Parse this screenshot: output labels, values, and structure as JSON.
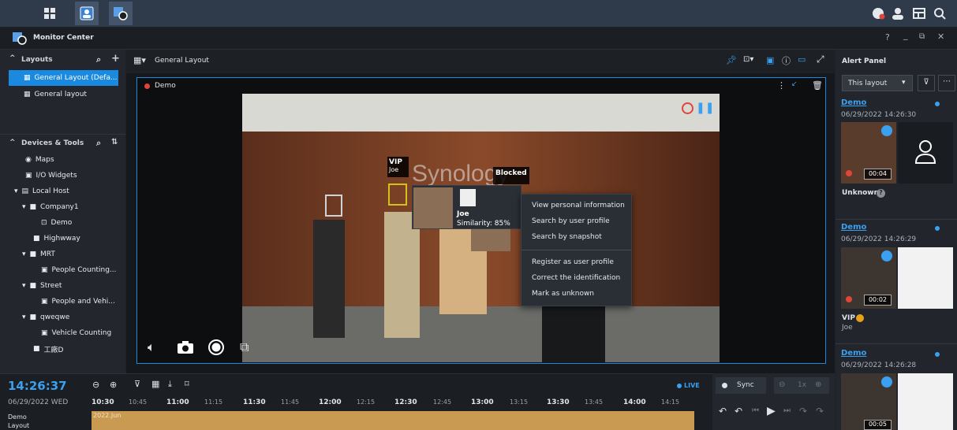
{
  "title": "Monitor Center",
  "layouts": {
    "header": "Layouts",
    "items": [
      "General Layout (Defa...",
      "General layout"
    ]
  },
  "devices": {
    "header": "Devices & Tools",
    "items": [
      {
        "label": "Maps"
      },
      {
        "label": "I/O Widgets"
      },
      {
        "label": "Local Host"
      },
      {
        "label": "Company1"
      },
      {
        "label": "Demo"
      },
      {
        "label": "Highwway"
      },
      {
        "label": "MRT"
      },
      {
        "label": "People Counting..."
      },
      {
        "label": "Street"
      },
      {
        "label": "People and Vehi..."
      },
      {
        "label": "qweqwe"
      },
      {
        "label": "Vehicle Counting"
      },
      {
        "label": "工廠D"
      }
    ]
  },
  "center": {
    "layout_name": "General Layout",
    "tile_name": "Demo"
  },
  "video": {
    "wall_text": "Synology",
    "tag_vip": "VIP",
    "tag_vip_name": "Joe",
    "tag_blocked": "Blocked",
    "popup_name": "Joe",
    "popup_similarity": "Similarity: 85%"
  },
  "context_menu": [
    "View personal information",
    "Search by user profile",
    "Search by snapshot",
    "Register as user profile",
    "Correct the identification",
    "Mark as unknown"
  ],
  "alert_panel": {
    "title": "Alert Panel",
    "filter": "This layout",
    "cards": [
      {
        "source": "Demo",
        "time": "06/29/2022 14:26:30",
        "duration": "00:04",
        "label": "Unknown"
      },
      {
        "source": "Demo",
        "time": "06/29/2022 14:26:29",
        "duration": "00:02",
        "label": "VIP",
        "sublabel": "Joe"
      },
      {
        "source": "Demo",
        "time": "06/29/2022 14:26:28",
        "duration": "00:05"
      }
    ]
  },
  "timeline": {
    "clock": "14:26:37",
    "date": "06/29/2022 WED",
    "ticks": [
      "10:30",
      "10:45",
      "11:00",
      "11:15",
      "11:30",
      "11:45",
      "12:00",
      "12:15",
      "12:30",
      "12:45",
      "13:00",
      "13:15",
      "13:30",
      "13:45",
      "14:00",
      "14:15"
    ],
    "track_label": "2022.Jun",
    "row1": "Demo",
    "row2": "Layout",
    "live": "LIVE",
    "sync": "Sync",
    "speed": "1x"
  }
}
